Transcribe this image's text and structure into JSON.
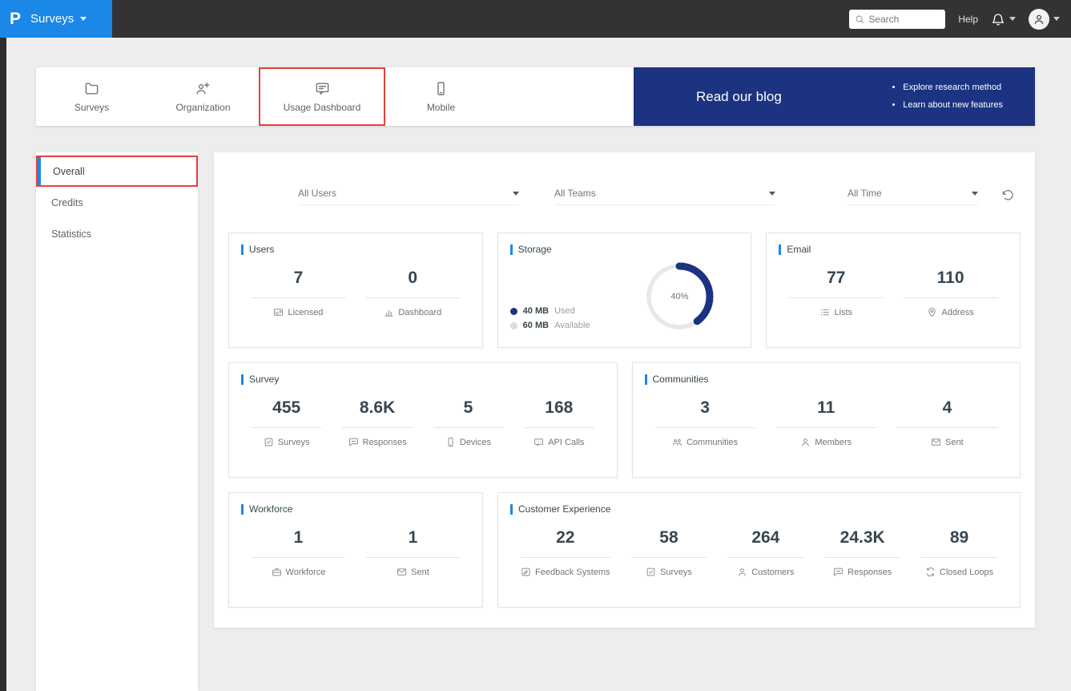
{
  "header": {
    "logo_letter": "P",
    "app_menu_label": "Surveys",
    "search_placeholder": "Search",
    "search_icon": "search-icon",
    "help_label": "Help",
    "bell_icon": "bell-icon",
    "avatar_icon": "user-icon"
  },
  "tabs": [
    {
      "label": "Surveys",
      "icon": "folder-icon"
    },
    {
      "label": "Organization",
      "icon": "organization-icon"
    },
    {
      "label": "Usage Dashboard",
      "icon": "usage-dashboard-icon"
    },
    {
      "label": "Mobile",
      "icon": "mobile-icon"
    }
  ],
  "banner": {
    "title": "Read our blog",
    "bullets": [
      "Explore research method",
      "Learn about new features"
    ],
    "background": "#1b3380"
  },
  "sidebar": {
    "items": [
      {
        "label": "Overall"
      },
      {
        "label": "Credits"
      },
      {
        "label": "Statistics"
      }
    ]
  },
  "filters": {
    "dropdowns": [
      {
        "value": "All Users"
      },
      {
        "value": "All Teams"
      },
      {
        "value": "All Time"
      }
    ],
    "reset_icon": "reset-icon"
  },
  "cards": [
    {
      "title": "Users",
      "stats": [
        {
          "value": "7",
          "label": "Licensed",
          "icon": "licensed-icon"
        },
        {
          "value": "0",
          "label": "Dashboard",
          "icon": "dashboard-icon"
        }
      ]
    },
    {
      "title": "Storage",
      "donut": {
        "percent": 40,
        "center_label": "40%",
        "used_color": "#1b3380",
        "available_color": "#e8e8e8"
      },
      "legend": [
        {
          "value": "40 MB",
          "label": "Used"
        },
        {
          "value": "60 MB",
          "label": "Available"
        }
      ]
    },
    {
      "title": "Email",
      "stats": [
        {
          "value": "77",
          "label": "Lists",
          "icon": "lists-icon"
        },
        {
          "value": "110",
          "label": "Address",
          "icon": "address-icon"
        }
      ]
    },
    {
      "title": "Survey",
      "stats": [
        {
          "value": "455",
          "label": "Surveys",
          "icon": "surveys-icon"
        },
        {
          "value": "8.6K",
          "label": "Responses",
          "icon": "responses-icon"
        },
        {
          "value": "5",
          "label": "Devices",
          "icon": "devices-icon"
        },
        {
          "value": "168",
          "label": "API Calls",
          "icon": "api-calls-icon"
        }
      ]
    },
    {
      "title": "Communities",
      "stats": [
        {
          "value": "3",
          "label": "Communities",
          "icon": "communities-icon"
        },
        {
          "value": "11",
          "label": "Members",
          "icon": "members-icon"
        },
        {
          "value": "4",
          "label": "Sent",
          "icon": "sent-icon"
        }
      ]
    },
    {
      "title": "Workforce",
      "stats": [
        {
          "value": "1",
          "label": "Workforce",
          "icon": "workforce-icon"
        },
        {
          "value": "1",
          "label": "Sent",
          "icon": "sent-icon"
        }
      ]
    },
    {
      "title": "Customer Experience",
      "stats": [
        {
          "value": "22",
          "label": "Feedback Systems",
          "icon": "feedback-systems-icon"
        },
        {
          "value": "58",
          "label": "Surveys",
          "icon": "surveys-icon"
        },
        {
          "value": "264",
          "label": "Customers",
          "icon": "customers-icon"
        },
        {
          "value": "24.3K",
          "label": "Responses",
          "icon": "responses-icon"
        },
        {
          "value": "89",
          "label": "Closed Loops",
          "icon": "closed-loops-icon"
        }
      ]
    }
  ],
  "colors": {
    "accent_blue": "#1b87e6",
    "navy": "#1b3380",
    "annotation_red": "#e8413c",
    "header_dark": "#333333"
  }
}
